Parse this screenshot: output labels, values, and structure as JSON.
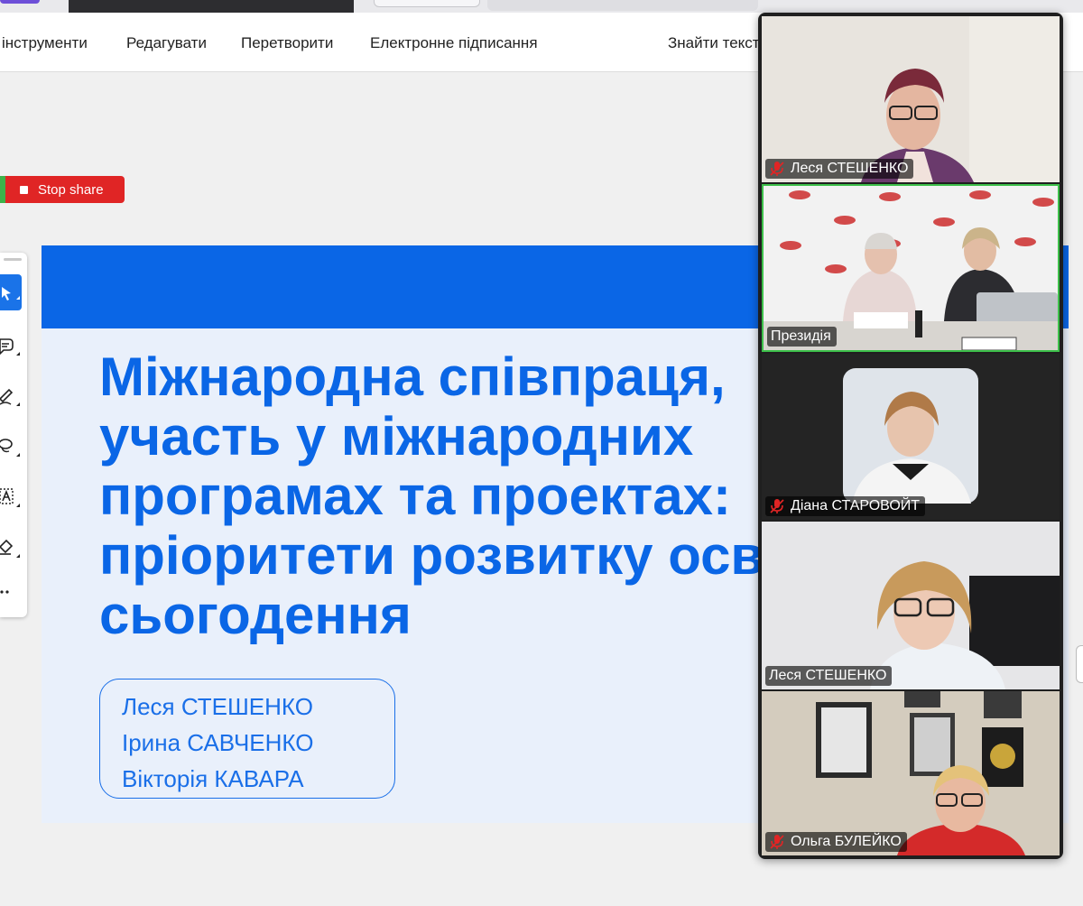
{
  "menubar": {
    "items": [
      "інструменти",
      "Редагувати",
      "Перетворити",
      "Електронне підписання",
      "Знайти текст"
    ]
  },
  "share": {
    "stop_label": "Stop share"
  },
  "slide": {
    "title_lines": [
      "Міжнародна співпраця,",
      "участь у міжнародних",
      "програмах та проектах:",
      "пріоритети розвитку осві",
      "сьогодення"
    ],
    "authors": [
      "Леся СТЕШЕНКО",
      "Ірина САВЧЕНКО",
      "Вікторія КАВАРА"
    ]
  },
  "participants": [
    {
      "name": "Леся СТЕШЕНКО",
      "muted": true
    },
    {
      "name": "Президія",
      "muted": false,
      "active_speaker": true
    },
    {
      "name": "Діана СТАРОВОЙТ",
      "muted": true
    },
    {
      "name": "Леся СТЕШЕНКО",
      "muted": false
    },
    {
      "name": "Ольга БУЛЕЙКО",
      "muted": true
    }
  ],
  "colors": {
    "slide_blue": "#0a66e6",
    "slide_bg": "#e9f0fb",
    "stop_share_red": "#e02525",
    "active_speaker_border": "#3dc04a"
  },
  "icons": [
    "select-arrow-icon",
    "comment-icon",
    "pen-icon",
    "lasso-icon",
    "text-box-icon",
    "stamp-icon",
    "more-icon",
    "mic-off-icon",
    "stop-square-icon"
  ]
}
